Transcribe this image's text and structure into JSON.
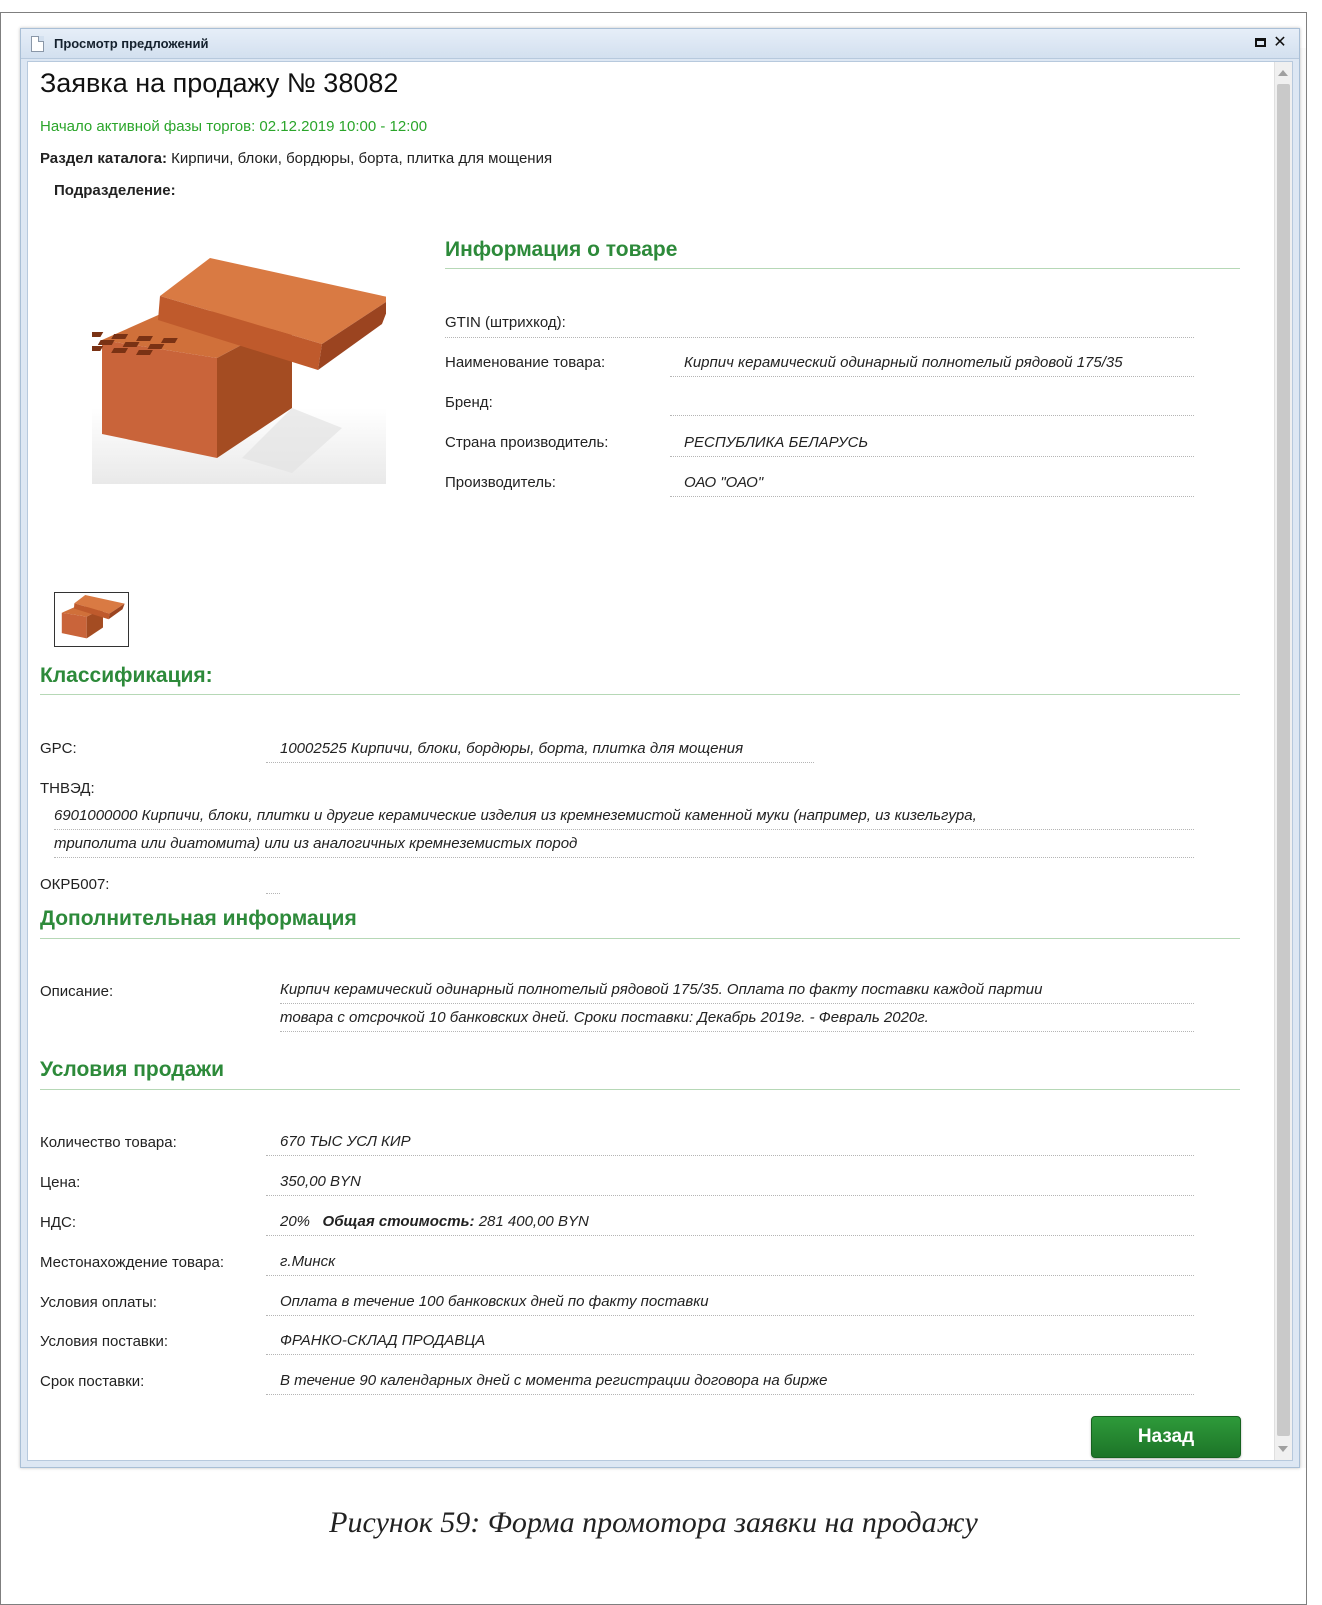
{
  "window": {
    "title": "Просмотр предложений"
  },
  "header": {
    "title": "Заявка на продажу № 38082",
    "phase_info": "Начало активной фазы торгов: 02.12.2019 10:00 - 12:00",
    "catalog_label": "Раздел каталога:",
    "catalog_value": "Кирпичи, блоки, бордюры, борта, плитка для мощения",
    "subdivision_label": "Подразделение:"
  },
  "product_info": {
    "title": "Информация о товаре",
    "rows": [
      {
        "label": "GTIN (штрихкод):",
        "value": ""
      },
      {
        "label": "Наименование товара:",
        "value": "Кирпич керамический одинарный полнотелый рядовой 175/35"
      },
      {
        "label": "Бренд:",
        "value": ""
      },
      {
        "label": "Страна производитель:",
        "value": "РЕСПУБЛИКА БЕЛАРУСЬ"
      },
      {
        "label": "Производитель:",
        "value": "ОАО \"ОАО\""
      }
    ]
  },
  "classification": {
    "title": "Классификация:",
    "gpc_label": "GPC:",
    "gpc_value": "10002525 Кирпичи, блоки, бордюры, борта, плитка для мощения",
    "tnved_label": "ТНВЭД:",
    "tnved_lines": [
      "6901000000 Кирпичи, блоки, плитки и другие керамические изделия из кремнеземистой каменной муки (например, из кизельгура,",
      "триполита или диатомита) или из аналогичных кремнеземистых пород"
    ],
    "okrb_label": "ОКРБ007:",
    "okrb_value": ""
  },
  "additional": {
    "title": "Дополнительная информация",
    "description_label": "Описание:",
    "description_lines": [
      "Кирпич керамический одинарный полнотелый рядовой 175/35. Оплата по факту поставки каждой партии",
      "товара с отсрочкой 10 банковских дней. Сроки поставки: Декабрь 2019г. - Февраль 2020г."
    ]
  },
  "sale_terms": {
    "title": "Условия продажи",
    "quantity_label": "Количество товара:",
    "quantity_value": "670 ТЫС УСЛ КИР",
    "price_label": "Цена:",
    "price_value": "350,00 BYN",
    "vat_label": "НДС:",
    "vat_value": "20%",
    "total_label": "Общая стоимость:",
    "total_value": "281 400,00 BYN",
    "location_label": "Местонахождение товара:",
    "location_value": "г.Минск",
    "payment_label": "Условия оплаты:",
    "payment_value": "Оплата в течение 100 банковских дней по факту поставки",
    "delivery_label": "Условия поставки:",
    "delivery_value": "ФРАНКО-СКЛАД ПРОДАВЦА",
    "term_label": "Срок поставки:",
    "term_value": "В течение 90 календарных дней с момента регистрации договора на бирже"
  },
  "buttons": {
    "back": "Назад"
  },
  "caption": "Рисунок 59: Форма промотора заявки на продажу",
  "colors": {
    "section_green": "#2d8a3a",
    "phase_green": "#2aa52a",
    "button_green": "#1d7428",
    "window_frame": "#dde7f3"
  },
  "icons": {
    "window_icon": "document-icon",
    "maximize": "maximize-icon",
    "close": "close-icon"
  }
}
